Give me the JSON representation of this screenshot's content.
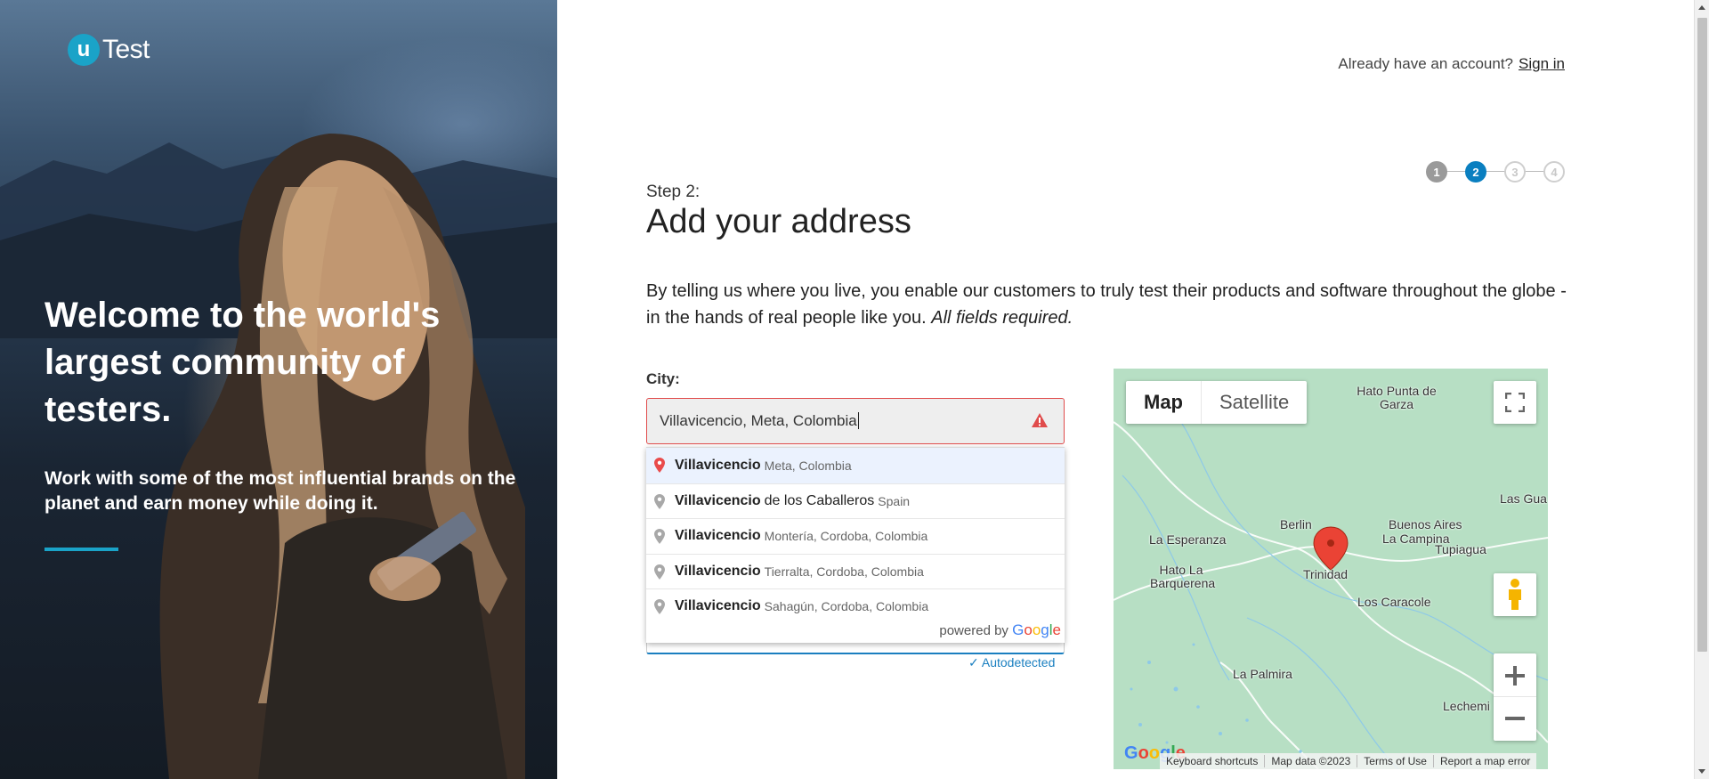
{
  "brand": {
    "logo_letter": "u",
    "logo_text": "Test",
    "accent": "#1aa3c8"
  },
  "hero": {
    "title": "Welcome to the world's largest community of testers.",
    "subtitle": "Work with some of the most influential brands on the planet and earn money while doing it."
  },
  "topbar": {
    "question": "Already have an account?",
    "signin_label": "Sign in"
  },
  "stepper": {
    "steps": [
      "1",
      "2",
      "3",
      "4"
    ],
    "current": 2
  },
  "form": {
    "step_label": "Step 2:",
    "title": "Add your address",
    "intro": "By telling us where you live, you enable our customers to truly test their products and software throughout the globe - in the hands of real people like you.",
    "intro_required": "All fields required.",
    "city_label": "City:",
    "city_value": "Villavicencio, Meta, Colombia",
    "autodetected": "Autodetected"
  },
  "autocomplete": {
    "items": [
      {
        "main": "Villavicencio",
        "rest": "",
        "secondary": "Meta, Colombia"
      },
      {
        "main": "Villavicencio",
        "rest": "de los Caballeros",
        "secondary": "Spain"
      },
      {
        "main": "Villavicencio",
        "rest": "",
        "secondary": "Montería, Cordoba, Colombia"
      },
      {
        "main": "Villavicencio",
        "rest": "",
        "secondary": "Tierralta, Cordoba, Colombia"
      },
      {
        "main": "Villavicencio",
        "rest": "",
        "secondary": "Sahagún, Cordoba, Colombia"
      }
    ],
    "powered_by": "powered by"
  },
  "map": {
    "map_label": "Map",
    "satellite_label": "Satellite",
    "labels": {
      "hato_punta": "Hato Punta de Garza",
      "las_gua": "Las Gua",
      "berlin": "Berlin",
      "buenos_aires": "Buenos Aires",
      "la_esperanza": "La Esperanza",
      "la_campina": "La Campina",
      "tupiagua": "Tupiagua",
      "hato_la": "Hato La Barquerena",
      "trinidad": "Trinidad",
      "los_caracoles": "Los Caracole",
      "la_palmira": "La Palmira",
      "lechemi": "Lechemi"
    },
    "footer": [
      "Keyboard shortcuts",
      "Map data ©2023",
      "Terms of Use",
      "Report a map error"
    ]
  }
}
